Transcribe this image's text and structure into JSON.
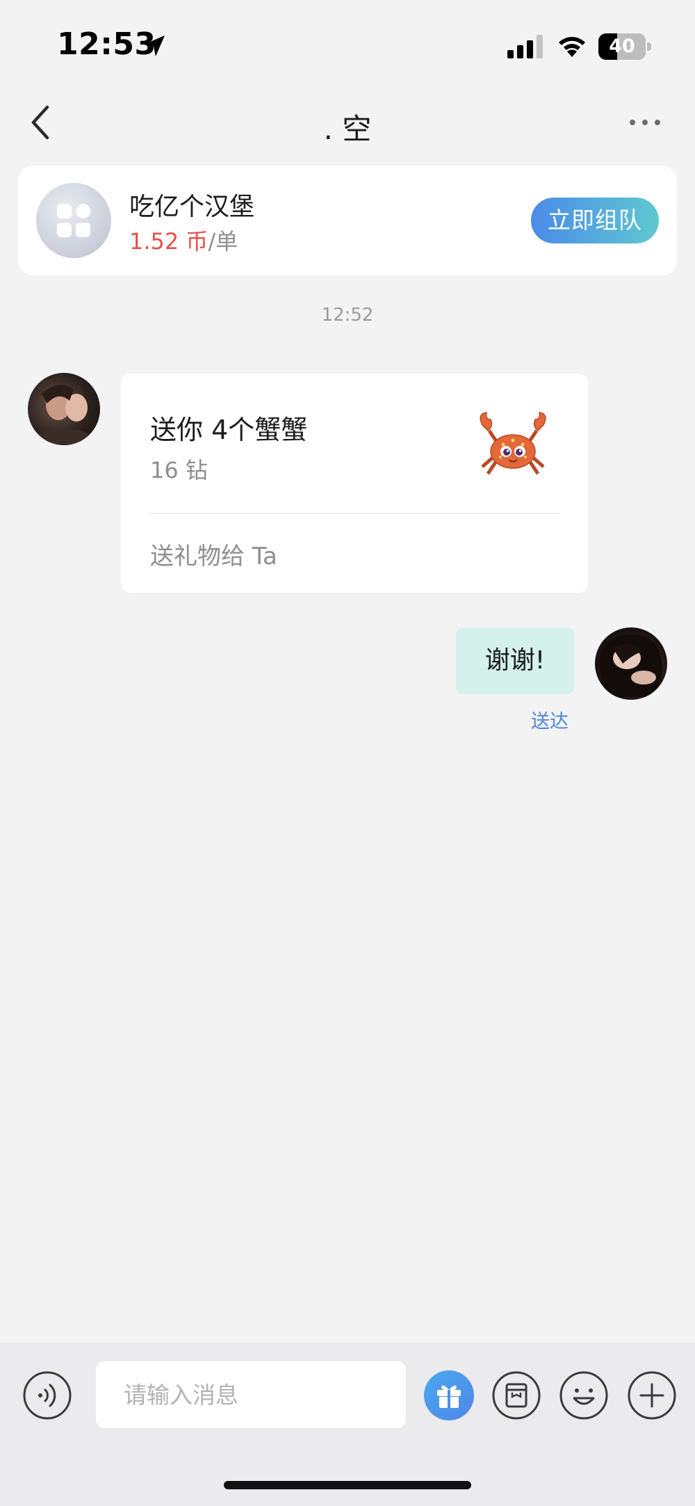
{
  "status_bar": {
    "time": "12:53",
    "battery": "40",
    "battery_level_percent": 40,
    "icons": [
      "location-arrow-icon",
      "signal-icon",
      "wifi-icon",
      "battery-icon"
    ]
  },
  "nav": {
    "title": ". 空",
    "icons": [
      "back-chevron-icon",
      "more-dots-icon"
    ]
  },
  "game_card": {
    "name": "吃亿个汉堡",
    "price_value": "1.52 币",
    "price_unit": "/单",
    "button_label": "立即组队",
    "icon": "app-grid-icon"
  },
  "chat": {
    "timestamp": "12:52",
    "messages": [
      {
        "direction": "incoming",
        "type": "gift",
        "title": "送你 4个蟹蟹",
        "cost": "16 钻",
        "action": "送礼物给 Ta",
        "icon": "crab-icon"
      },
      {
        "direction": "outgoing",
        "type": "text",
        "text": "谢谢!",
        "status": "送达"
      }
    ]
  },
  "input_bar": {
    "placeholder": "请输入消息",
    "icons": [
      "voice-icon",
      "gift-icon",
      "bag-icon",
      "emoji-icon",
      "plus-icon"
    ]
  },
  "colors": {
    "background": "#f3f3f4",
    "price": "#e8504a",
    "button_gradient_start": "#4b8be8",
    "button_gradient_end": "#5fc8d0",
    "outgoing_bubble": "#d4f1ec",
    "delivered": "#4b86d9"
  }
}
